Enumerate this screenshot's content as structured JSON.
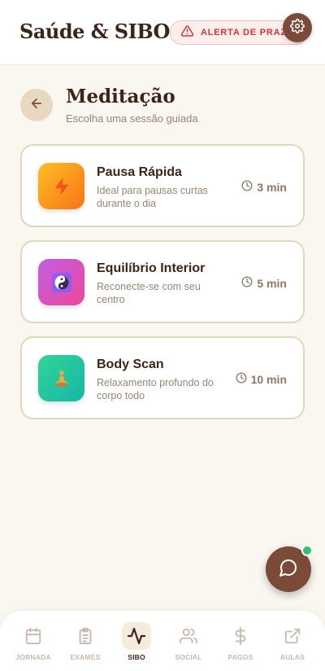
{
  "header": {
    "title": "Saúde & SIBO",
    "alert_label": "ALERTA DE PRAZO",
    "settings_icon": "gear-icon"
  },
  "page": {
    "title": "Meditação",
    "subtitle": "Escolha uma sessão guiada"
  },
  "sessions": [
    {
      "title": "Pausa Rápida",
      "description": "Ideal para pausas curtas durante o dia",
      "duration": "3 min",
      "icon": "lightning-icon",
      "color_from": "#fbbf24",
      "color_to": "#f97316"
    },
    {
      "title": "Equilíbrio Interior",
      "description": "Reconecte-se com seu centro",
      "duration": "5 min",
      "icon": "yin-yang-icon",
      "color_from": "#c25ee6",
      "color_to": "#ec4899"
    },
    {
      "title": "Body Scan",
      "description": "Relaxamento profundo do corpo todo",
      "duration": "10 min",
      "icon": "meditating-person-icon",
      "color_from": "#34d399",
      "color_to": "#14b8a6"
    }
  ],
  "nav": {
    "items": [
      {
        "label": "JORNADA",
        "icon": "calendar-icon",
        "active": false
      },
      {
        "label": "EXAMES",
        "icon": "clipboard-icon",
        "active": false
      },
      {
        "label": "SIBO",
        "icon": "activity-icon",
        "active": true
      },
      {
        "label": "SOCIAL",
        "icon": "users-icon",
        "active": false
      },
      {
        "label": "PAGOS",
        "icon": "dollar-icon",
        "active": false
      },
      {
        "label": "AULAS",
        "icon": "external-link-icon",
        "active": false
      }
    ]
  },
  "colors": {
    "brand": "#7b4a38",
    "alert": "#d93333",
    "online": "#2ec26a"
  }
}
